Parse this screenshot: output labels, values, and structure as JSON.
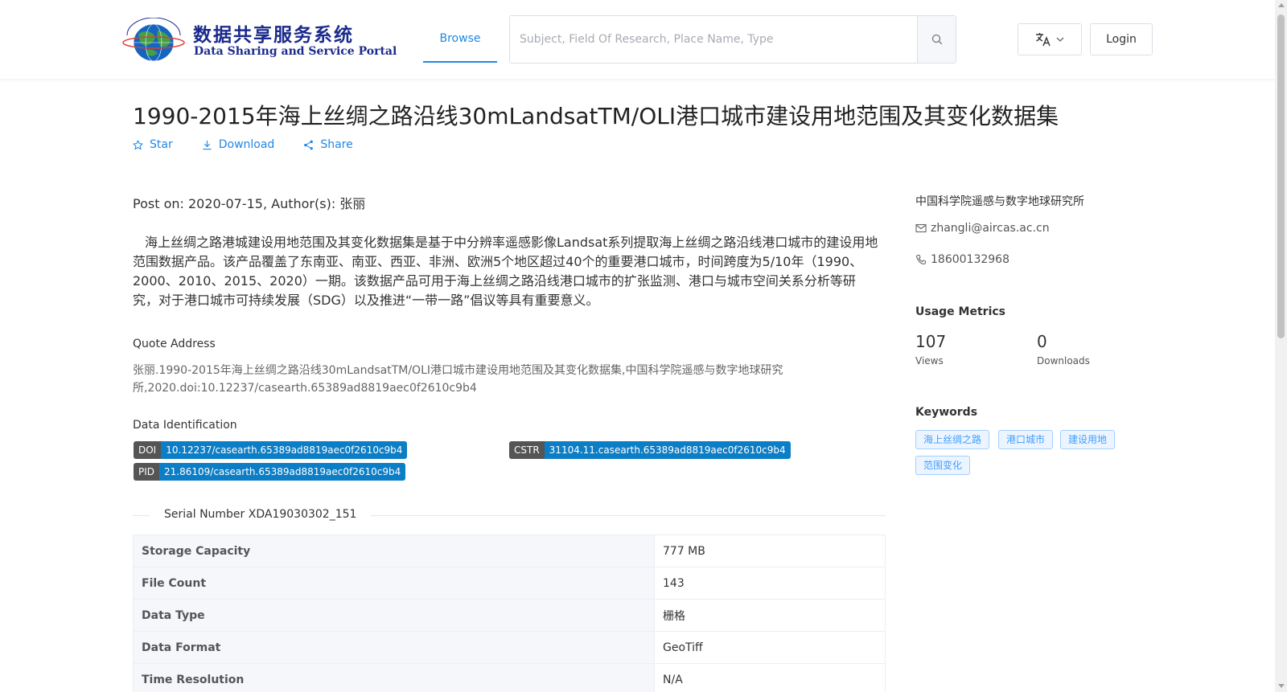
{
  "header": {
    "logo_cn": "数据共享服务系统",
    "logo_en": "Data Sharing and Service Portal",
    "nav_browse": "Browse",
    "search_placeholder": "Subject, Field Of Research, Place Name, Type",
    "login": "Login",
    "accent": "#1e88e5"
  },
  "dataset": {
    "title": "1990-2015年海上丝绸之路沿线30mLandsatTM/OLI港口城市建设用地范围及其变化数据集",
    "actions": {
      "star": "Star",
      "download": "Download",
      "share": "Share"
    },
    "post_on": "Post on: 2020-07-15, Author(s): 张丽",
    "description": "海上丝绸之路港城建设用地范围及其变化数据集是基于中分辨率遥感影像Landsat系列提取海上丝绸之路沿线港口城市的建设用地范围数据产品。该产品覆盖了东南亚、南亚、西亚、非洲、欧洲5个地区超过40个的重要港口城市，时间跨度为5/10年（1990、2000、2010、2015、2020）一期。该数据产品可用于海上丝绸之路沿线港口城市的扩张监测、港口与城市空间关系分析等研究，对于港口城市可持续发展（SDG）以及推进“一带一路”倡议等具有重要意义。",
    "quote_label": "Quote Address",
    "quote_text": "张丽.1990-2015年海上丝绸之路沿线30mLandsatTM/OLI港口城市建设用地范围及其变化数据集,中国科学院遥感与数字地球研究所,2020.doi:10.12237/casearth.65389ad8819aec0f2610c9b4",
    "ident_label": "Data Identification",
    "doi": {
      "key": "DOI",
      "value": "10.12237/casearth.65389ad8819aec0f2610c9b4"
    },
    "cstr": {
      "key": "CSTR",
      "value": "31104.11.casearth.65389ad8819aec0f2610c9b4"
    },
    "pid": {
      "key": "PID",
      "value": "21.86109/casearth.65389ad8819aec0f2610c9b4"
    },
    "serial": "Serial Number XDA19030302_151",
    "table": [
      {
        "key": "Storage Capacity",
        "value": "777 MB"
      },
      {
        "key": "File Count",
        "value": "143"
      },
      {
        "key": "Data Type",
        "value": "栅格"
      },
      {
        "key": "Data Format",
        "value": "GeoTiff"
      },
      {
        "key": "Time Resolution",
        "value": "N/A"
      }
    ]
  },
  "sidebar": {
    "org": "中国科学院遥感与数字地球研究所",
    "email": "zhangli@aircas.ac.cn",
    "phone": "18600132968",
    "metrics_title": "Usage Metrics",
    "views": "107",
    "views_label": "Views",
    "downloads": "0",
    "downloads_label": "Downloads",
    "keywords_title": "Keywords",
    "keywords": [
      "海上丝绸之路",
      "港口城市",
      "建设用地",
      "范围变化"
    ]
  }
}
